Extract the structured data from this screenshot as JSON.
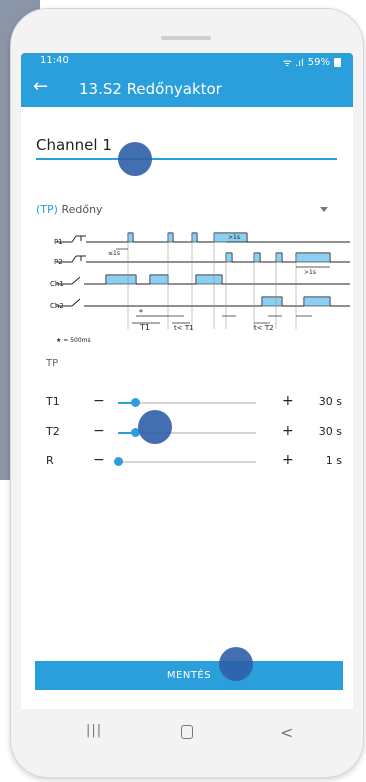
{
  "status": {
    "time": "11:40",
    "signal": "ᯤ .ıl",
    "battery": "59%"
  },
  "appbar": {
    "back_icon": "arrow-left-icon",
    "title": "13.S2 Redőnyaktor"
  },
  "channel": {
    "name": "Channel 1"
  },
  "mode": {
    "prefix": "(TP)",
    "label": "Redőny"
  },
  "diagram": {
    "rows": [
      "P1",
      "P2",
      "Ch1",
      "Ch2"
    ],
    "annotations": {
      "lt1s": "≤1s",
      "gt1s_a": ">1s",
      "gt1s_b": ">1s",
      "star": "*",
      "t1": "T1",
      "t_lt_t1": "t< T1",
      "t_lt_t2": "t< T2",
      "legend": "★ = 500ms"
    }
  },
  "section_label": "TP",
  "params": [
    {
      "name": "T1",
      "minus": "−",
      "plus": "+",
      "value": "30 s",
      "level": 0.12
    },
    {
      "name": "T2",
      "minus": "−",
      "plus": "+",
      "value": "30 s",
      "level": 0.12
    },
    {
      "name": "R",
      "minus": "−",
      "plus": "+",
      "value": "1 s",
      "level": 0.0
    }
  ],
  "save_button": {
    "label": "MENTÉS"
  },
  "navbar": {
    "recent": "|||",
    "home": "home-icon",
    "back": "<"
  },
  "colors": {
    "accent": "#2a9fdb",
    "pulse_fill": "#8ccff2",
    "touch": "#2f5fa8"
  }
}
